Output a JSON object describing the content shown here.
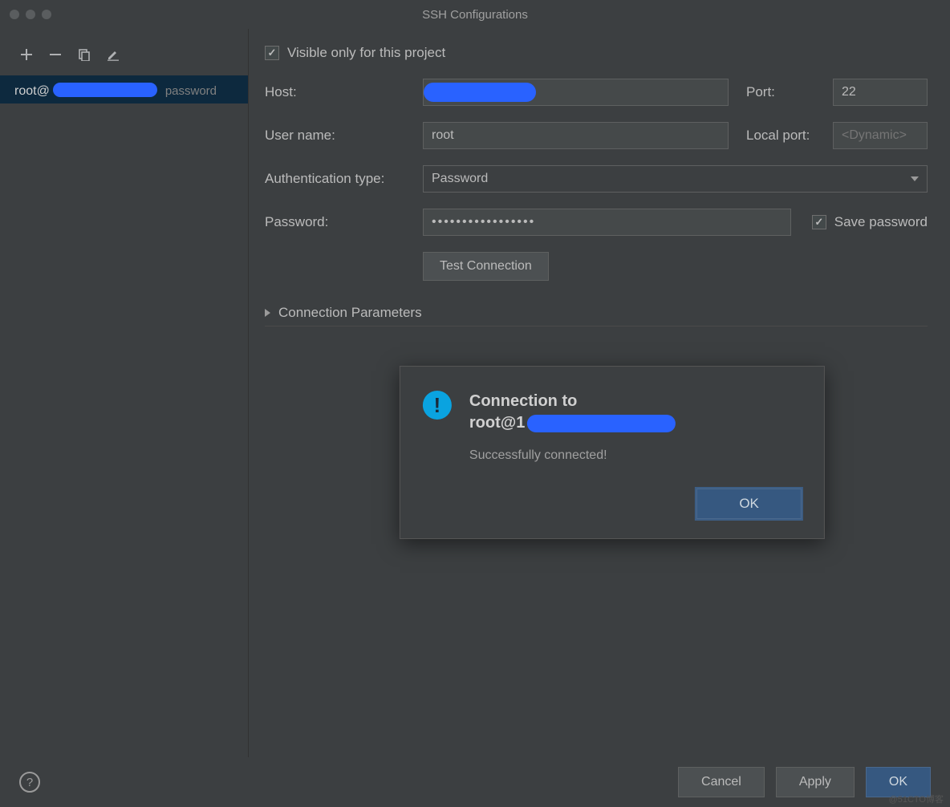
{
  "window": {
    "title": "SSH Configurations"
  },
  "sidebar": {
    "config": {
      "user_prefix": "root@",
      "auth_suffix": "password"
    }
  },
  "form": {
    "visible_only_label": "Visible only for this project",
    "visible_only_checked": true,
    "host": {
      "label": "Host:"
    },
    "port": {
      "label": "Port:",
      "value": "22"
    },
    "username": {
      "label": "User name:",
      "value": "root"
    },
    "local_port": {
      "label": "Local port:",
      "placeholder": "<Dynamic>"
    },
    "auth_type": {
      "label": "Authentication type:",
      "value": "Password"
    },
    "password": {
      "label": "Password:",
      "masked": "•••••••••••••••••"
    },
    "save_password": {
      "label": "Save password",
      "checked": true
    },
    "test_button": "Test Connection",
    "connection_params": "Connection Parameters"
  },
  "modal": {
    "title_line1": "Connection to",
    "title_line2_prefix": "root@1",
    "message": "Successfully connected!",
    "ok": "OK"
  },
  "footer": {
    "help": "?",
    "cancel": "Cancel",
    "apply": "Apply",
    "ok": "OK"
  },
  "watermark": "@51CTO博客"
}
